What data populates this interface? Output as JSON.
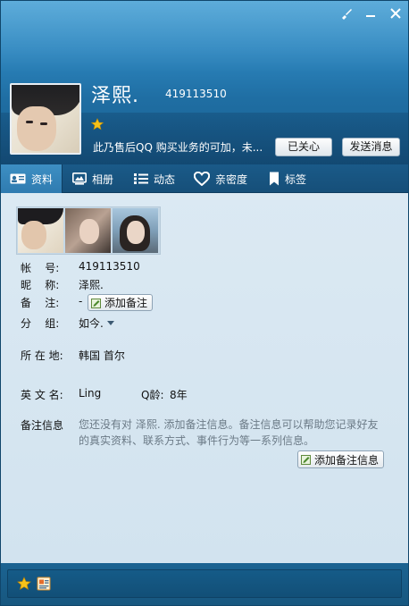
{
  "profile": {
    "nickname": "泽熙.",
    "qq_number": "419113510",
    "signature": "此乃售后QQ 购买业务的可加，未...",
    "care_button": "已关心",
    "send_message_button": "发送消息"
  },
  "tabs": [
    {
      "label": "资料",
      "icon": "profile-card-icon",
      "selected": true
    },
    {
      "label": "相册",
      "icon": "album-icon"
    },
    {
      "label": "动态",
      "icon": "list-icon"
    },
    {
      "label": "亲密度",
      "icon": "heart-icon"
    },
    {
      "label": "标签",
      "icon": "bookmark-icon"
    }
  ],
  "details": {
    "account_label": "帐    号:",
    "account_value": "419113510",
    "nickname_label": "昵    称:",
    "nickname_value": "泽熙.",
    "remark_label": "备    注:",
    "remark_value": "-",
    "add_remark_button": "添加备注",
    "group_label": "分    组:",
    "group_value": "如今.",
    "location_label": "所 在 地:",
    "location_value": "韩国 首尔",
    "english_name_label": "英 文 名:",
    "english_name_value": "Ling",
    "qq_age_label": "Q龄:",
    "qq_age_value": "8年",
    "remark_info_label": "备注信息",
    "remark_info_note": "您还没有对 泽熙. 添加备注信息。备注信息可以帮助您记录好友的真实资料、联系方式、事件行为等一系列信息。",
    "add_remark_info_button": "添加备注信息"
  },
  "colors": {
    "header_blue": "#2d86bf",
    "tab_bar": "#164f79",
    "content_bg": "#d6e6f1",
    "star_gold": "#f6c21a"
  }
}
